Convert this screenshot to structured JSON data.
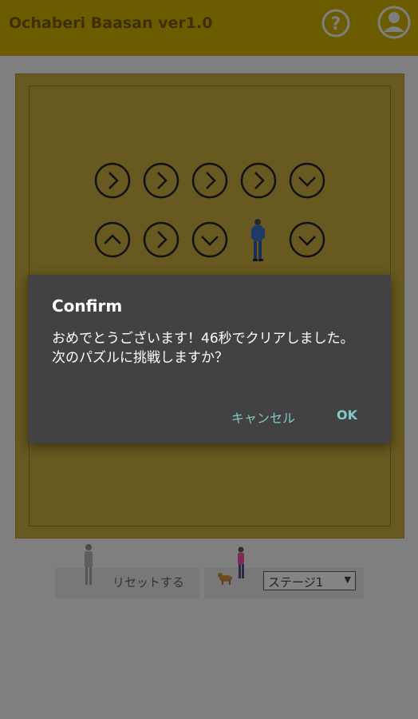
{
  "app": {
    "title": "Ochaberi Baasan ver1.0",
    "help_icon": "help-circle-icon",
    "account_icon": "account-circle-icon"
  },
  "board": {
    "tiles": [
      {
        "direction": "right",
        "icon": "arrow-right-circle-icon"
      },
      {
        "direction": "right",
        "icon": "arrow-right-circle-icon"
      },
      {
        "direction": "right",
        "icon": "arrow-right-circle-icon"
      },
      {
        "direction": "right",
        "icon": "arrow-right-circle-icon"
      },
      {
        "direction": "down",
        "icon": "arrow-down-circle-icon"
      },
      {
        "direction": "up",
        "icon": "arrow-up-circle-icon"
      },
      {
        "direction": "right",
        "icon": "arrow-right-circle-icon"
      },
      {
        "direction": "down",
        "icon": "arrow-down-circle-icon"
      },
      {
        "direction": "player",
        "icon": "player-figure-icon"
      },
      {
        "direction": "down",
        "icon": "arrow-down-circle-icon"
      }
    ]
  },
  "controls": {
    "reset_label": "リセットする",
    "stage_select_value": "ステージ1"
  },
  "dialog": {
    "title": "Confirm",
    "message": "おめでとうございます！46秒でクリアしました。\n次のパズルに挑戦しますか？",
    "cancel_label": "キャンセル",
    "ok_label": "OK"
  },
  "colors": {
    "appbar": "#6b5c00",
    "board": "#67591f",
    "dialog_bg": "#424242",
    "dialog_button": "#80cbc4"
  }
}
